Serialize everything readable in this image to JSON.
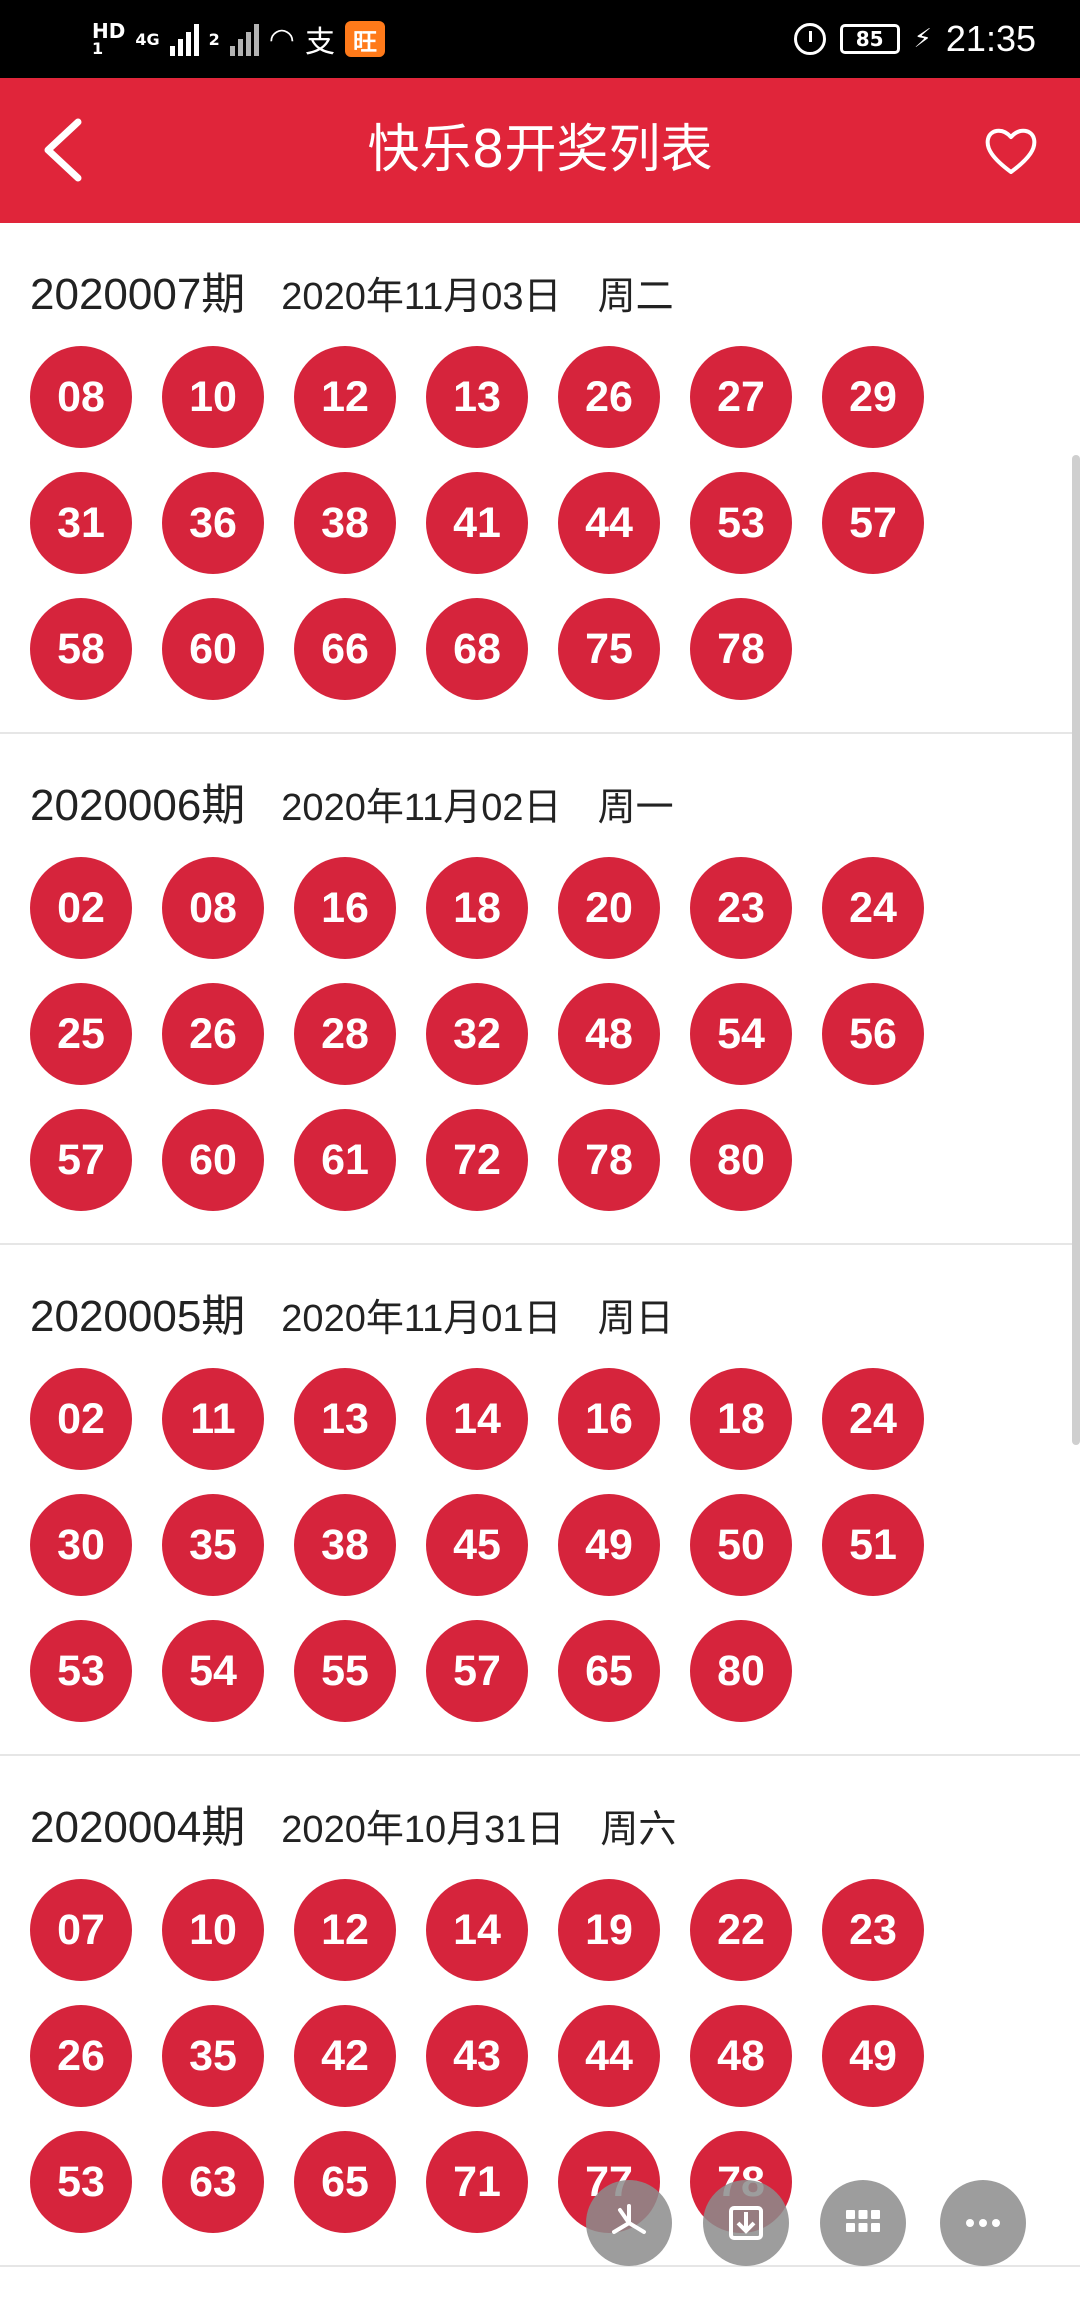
{
  "status_bar": {
    "hd_label": "HD",
    "sim1": "1",
    "sim2": "2",
    "network": "4G",
    "pay_icon_text": "支",
    "app_icon_text": "旺",
    "battery": "85",
    "time": "21:35"
  },
  "header": {
    "title": "快乐8开奖列表",
    "accent_color": "#e0253a"
  },
  "ball_color": "#d6243c",
  "draws": [
    {
      "issue": "2020007期",
      "date": "2020年11月03日",
      "weekday": "周二",
      "numbers": [
        "08",
        "10",
        "12",
        "13",
        "26",
        "27",
        "29",
        "31",
        "36",
        "38",
        "41",
        "44",
        "53",
        "57",
        "58",
        "60",
        "66",
        "68",
        "75",
        "78"
      ]
    },
    {
      "issue": "2020006期",
      "date": "2020年11月02日",
      "weekday": "周一",
      "numbers": [
        "02",
        "08",
        "16",
        "18",
        "20",
        "23",
        "24",
        "25",
        "26",
        "28",
        "32",
        "48",
        "54",
        "56",
        "57",
        "60",
        "61",
        "72",
        "78",
        "80"
      ]
    },
    {
      "issue": "2020005期",
      "date": "2020年11月01日",
      "weekday": "周日",
      "numbers": [
        "02",
        "11",
        "13",
        "14",
        "16",
        "18",
        "24",
        "30",
        "35",
        "38",
        "45",
        "49",
        "50",
        "51",
        "53",
        "54",
        "55",
        "57",
        "65",
        "80"
      ]
    },
    {
      "issue": "2020004期",
      "date": "2020年10月31日",
      "weekday": "周六",
      "numbers": [
        "07",
        "10",
        "12",
        "14",
        "19",
        "22",
        "23",
        "26",
        "35",
        "42",
        "43",
        "44",
        "48",
        "49",
        "53",
        "63",
        "65",
        "71",
        "77",
        "78"
      ]
    }
  ],
  "fab_icons": [
    "pinwheel-icon",
    "download-icon",
    "grid-icon",
    "more-icon"
  ]
}
